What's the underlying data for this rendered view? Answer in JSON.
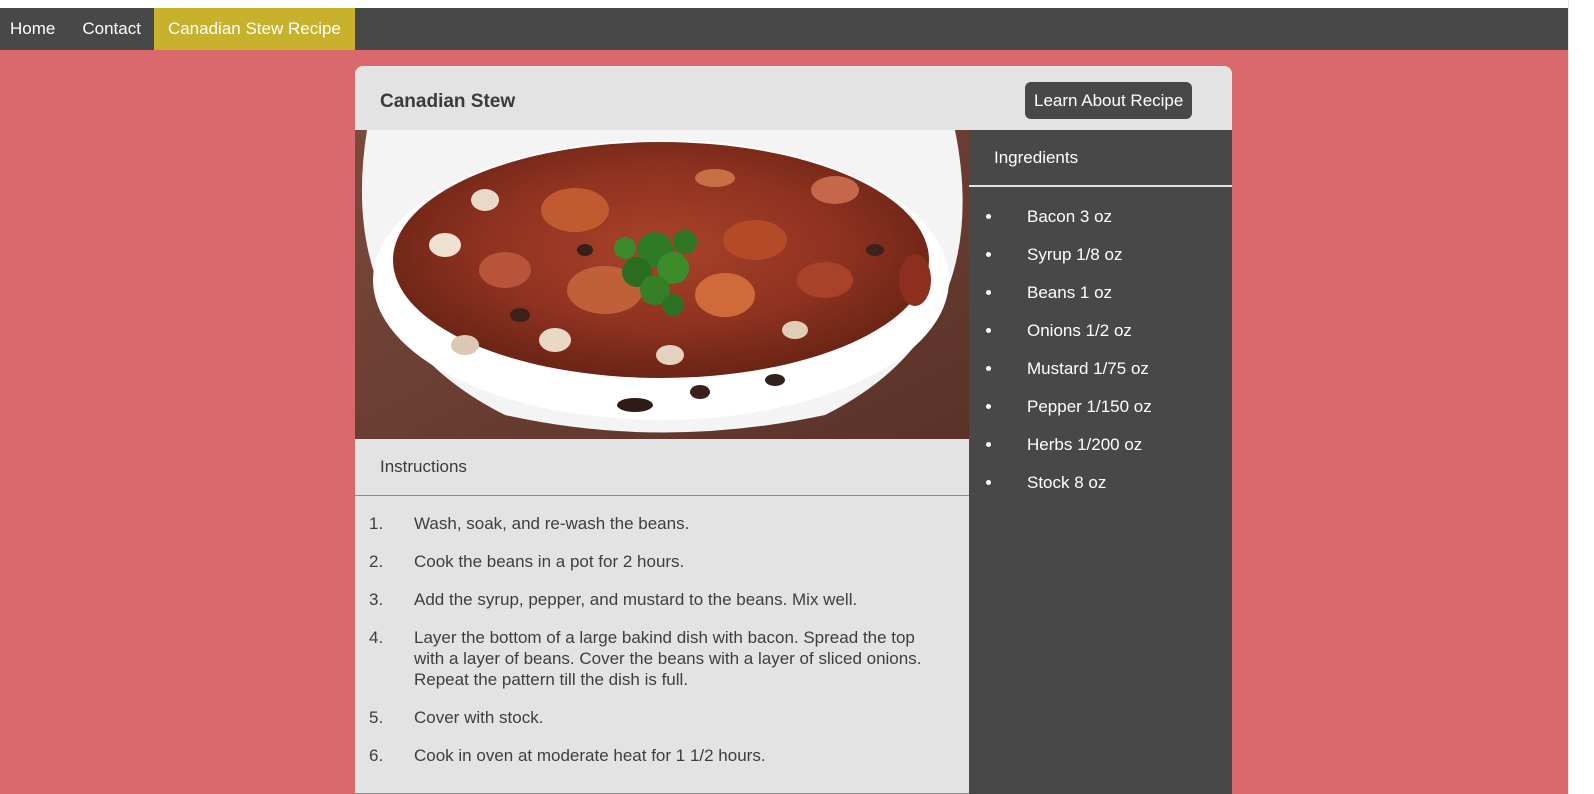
{
  "nav": {
    "items": [
      {
        "label": "Home"
      },
      {
        "label": "Contact"
      },
      {
        "label": "Canadian Stew Recipe",
        "active": true
      }
    ]
  },
  "recipe": {
    "title": "Canadian Stew",
    "learn_button": "Learn About Recipe",
    "photo_alt": "stew-bowl-photo"
  },
  "instructions": {
    "heading": "Instructions",
    "steps": [
      {
        "num": "1.",
        "text": "Wash, soak, and re-wash the beans."
      },
      {
        "num": "2.",
        "text": "Cook the beans in a pot for 2 hours."
      },
      {
        "num": "3.",
        "text": "Add the syrup, pepper, and mustard to the beans. Mix well."
      },
      {
        "num": "4.",
        "text": "Layer the bottom of a large bakind dish with bacon. Spread the top with a layer of beans. Cover the beans with a layer of sliced onions. Repeat the pattern till the dish is full."
      },
      {
        "num": "5.",
        "text": "Cover with stock."
      },
      {
        "num": "6.",
        "text": "Cook in oven at moderate heat for 1 1/2 hours."
      }
    ]
  },
  "ingredients": {
    "heading": "Ingredients",
    "items": [
      "Bacon 3 oz",
      "Syrup 1/8 oz",
      "Beans 1 oz",
      "Onions 1/2 oz",
      "Mustard 1/75 oz",
      "Pepper 1/150 oz",
      "Herbs 1/200 oz",
      "Stock 8 oz"
    ]
  },
  "colors": {
    "page_background": "#d9696c",
    "nav_background": "#484848",
    "nav_active": "#c8b22d",
    "card_background": "#e3e3e3",
    "ingredients_background": "#484848"
  }
}
